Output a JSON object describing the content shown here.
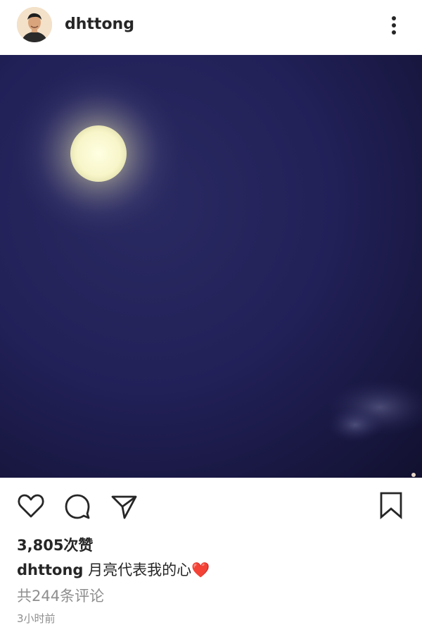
{
  "post": {
    "username": "dhttong",
    "caption_username": "dhttong",
    "caption_text": "月亮代表我的心❤️",
    "likes": "3,805次赞",
    "comments_link": "共244条评论",
    "timestamp": "3小时前"
  },
  "icons": {
    "avatar": "avatar",
    "more": "more-options-icon",
    "like": "heart-icon",
    "comment": "comment-bubble-icon",
    "share": "paper-plane-icon",
    "save": "bookmark-icon"
  },
  "colors": {
    "night_sky": "#1b1a48",
    "moon": "#f6f5c4",
    "text": "#262626",
    "muted": "#8e8e8e"
  }
}
